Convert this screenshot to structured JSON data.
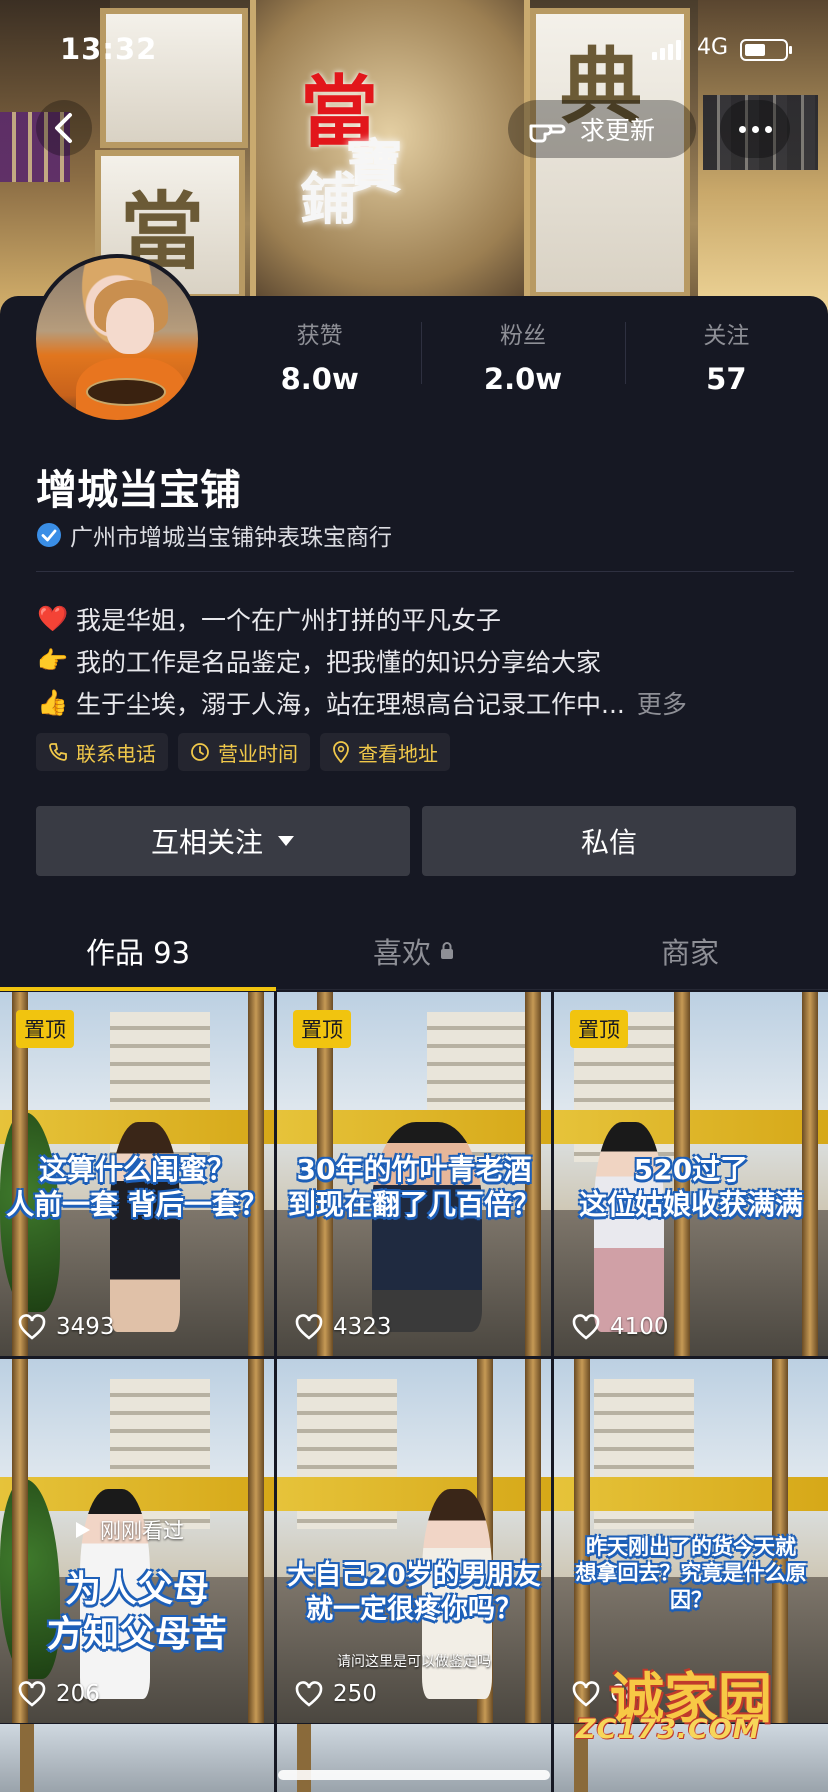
{
  "status_bar": {
    "time": "13:32",
    "network": "4G"
  },
  "banner": {
    "sign_chars": {
      "dang": "當",
      "bao": "寶",
      "pu": "鋪",
      "dian": "典",
      "dang2": "當"
    }
  },
  "nav": {
    "request_update": "求更新"
  },
  "profile": {
    "name": "增城当宝铺",
    "verified_label": "广州市增城当宝铺钟表珠宝商行",
    "stats": [
      {
        "label": "获赞",
        "value": "8.0w"
      },
      {
        "label": "粉丝",
        "value": "2.0w"
      },
      {
        "label": "关注",
        "value": "57"
      }
    ],
    "bio": [
      {
        "emoji": "❤️",
        "text": " 我是华姐，一个在广州打拼的平凡女子"
      },
      {
        "emoji": "👉",
        "text": "我的工作是名品鉴定，把我懂的知识分享给大家"
      },
      {
        "emoji": "👍",
        "text": "生于尘埃，溺于人海，站在理想高台记录工作中..."
      }
    ],
    "bio_more": "更多",
    "chips": [
      "联系电话",
      "营业时间",
      "查看地址"
    ],
    "follow_button": "互相关注",
    "message_button": "私信"
  },
  "tabs": [
    {
      "label": "作品 93"
    },
    {
      "label": "喜欢"
    },
    {
      "label": "商家"
    }
  ],
  "videos": [
    {
      "pinned": "置顶",
      "caption": "这算什么闺蜜？\n人前一套 背后一套？",
      "likes": "3493"
    },
    {
      "pinned": "置顶",
      "caption": "30年的竹叶青老酒\n到现在翻了几百倍？",
      "likes": "4323"
    },
    {
      "pinned": "置顶",
      "caption": "520过了\n这位姑娘收获满满",
      "likes": "4100"
    },
    {
      "watched": "刚刚看过",
      "caption": "为人父母\n方知父母苦",
      "likes": "206"
    },
    {
      "caption": "大自己20岁的男朋友\n就一定很疼你吗？",
      "subtitle": "请问这里是可以做鉴定吗",
      "likes": "250"
    },
    {
      "caption": "昨天刚出了的货今天就\n想拿回去？究竟是什么原因？",
      "likes": "68"
    }
  ],
  "watermark": {
    "line1": "诚家园",
    "line2": "ZC173.COM"
  },
  "colors": {
    "background": "#161823",
    "accent": "#f1c40f",
    "button": "#393b44",
    "verify_blue": "#3a8ee6"
  }
}
